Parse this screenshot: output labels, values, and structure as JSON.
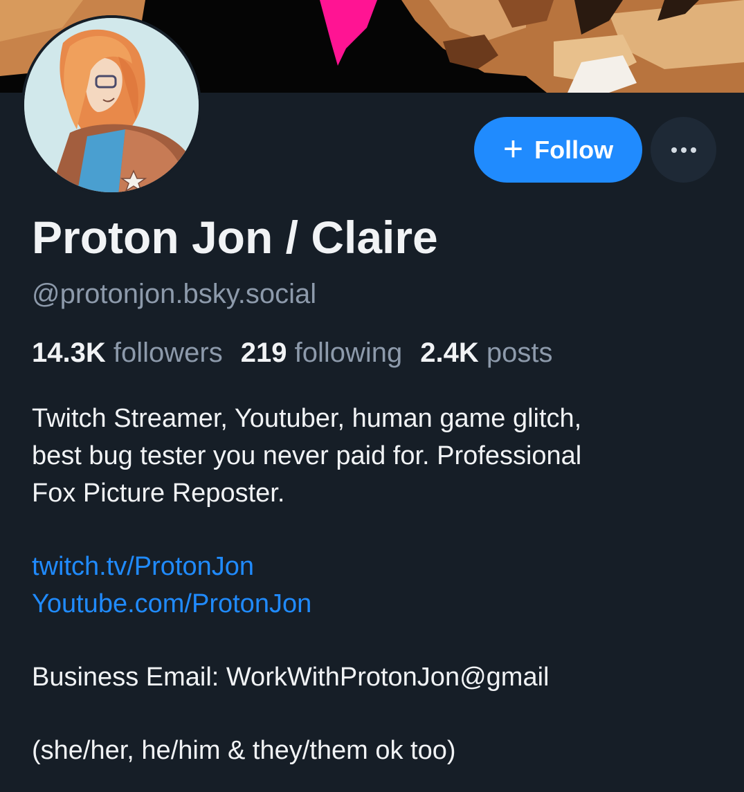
{
  "profile": {
    "display_name": "Proton Jon / Claire",
    "handle": "@protonjon.bsky.social",
    "avatar_icon": "avatar-illustration-icon",
    "banner_icon": "pixel-art-banner-icon"
  },
  "actions": {
    "follow_label": "Follow",
    "follow_icon": "plus-icon",
    "more_icon": "ellipsis-icon"
  },
  "stats": {
    "followers_count": "14.3K",
    "followers_label": "followers",
    "following_count": "219",
    "following_label": "following",
    "posts_count": "2.4K",
    "posts_label": "posts"
  },
  "bio": {
    "line1": "Twitch Streamer, Youtuber, human game glitch,",
    "line2": "best bug tester you never paid for.  Professional",
    "line3": "Fox Picture Reposter.",
    "link1": "twitch.tv/ProtonJon",
    "link2": "Youtube.com/ProtonJon",
    "email_line": "Business Email: WorkWithProtonJon@gmail",
    "pronouns_line": "(she/her, he/him & they/them ok too)"
  },
  "colors": {
    "background": "#161e27",
    "accent": "#208bfe",
    "muted_text": "#8d9aab",
    "primary_text": "#f1f3f5",
    "more_button_bg": "#1e2936"
  }
}
